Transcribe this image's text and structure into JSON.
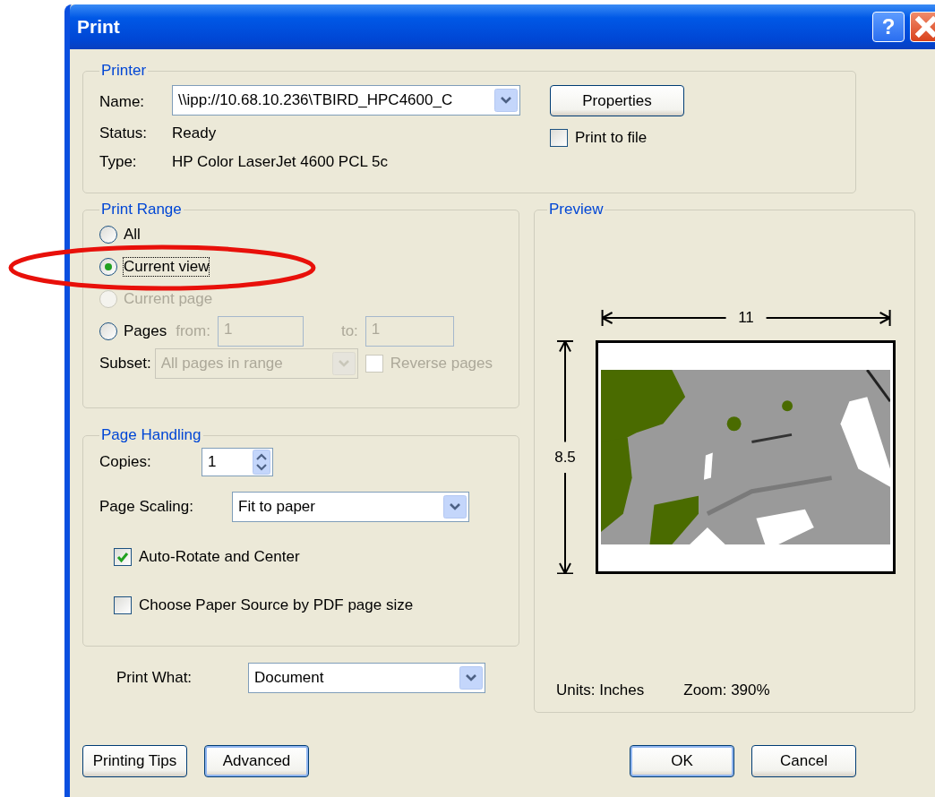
{
  "window": {
    "title": "Print"
  },
  "title_buttons": [
    {
      "kind": "help",
      "label": "?"
    },
    {
      "kind": "close"
    }
  ],
  "printer": {
    "title": "Printer",
    "name_label": "Name:",
    "name_value": "\\\\ipp://10.68.10.236\\TBIRD_HPC4600_C",
    "status_label": "Status:",
    "status": "Ready",
    "type_label": "Type:",
    "type": "HP Color LaserJet 4600 PCL 5c",
    "properties_button": "Properties",
    "print_to_file": {
      "label": "Print to file",
      "checked": false
    }
  },
  "print_range": {
    "title": "Print Range",
    "options": [
      {
        "label": "All",
        "selected": false,
        "disabled": false,
        "focused": false
      },
      {
        "label": "Current view",
        "selected": true,
        "disabled": false,
        "focused": true
      },
      {
        "label": "Current page",
        "selected": false,
        "disabled": true,
        "focused": false
      },
      {
        "label": "Pages",
        "selected": false,
        "disabled": false,
        "focused": false
      }
    ],
    "from_label": "from:",
    "from_value": "1",
    "to_label": "to:",
    "to_value": "1",
    "page_fields_disabled": true,
    "subset_label": "Subset:",
    "subset_value": "All pages in range",
    "subset_disabled": true,
    "reverse_pages": {
      "label": "Reverse pages",
      "checked": false,
      "disabled": true
    }
  },
  "page_handling": {
    "title": "Page Handling",
    "copies_label": "Copies:",
    "copies_value": "1",
    "scaling_label": "Page Scaling:",
    "scaling_value": "Fit to paper",
    "options": [
      {
        "label": "Auto-Rotate and Center",
        "checked": true
      },
      {
        "label": "Choose Paper Source by PDF page size",
        "checked": false
      }
    ]
  },
  "print_what": {
    "label": "Print What:",
    "value": "Document"
  },
  "preview": {
    "title": "Preview",
    "width_label": "11",
    "height_label": "8.5",
    "units": "Units: Inches",
    "zoom": "Zoom: 390%"
  },
  "buttons": [
    {
      "label": "Printing Tips",
      "default": false
    },
    {
      "label": "Advanced",
      "default": true
    },
    {
      "label": "OK",
      "default": true
    },
    {
      "label": "Cancel",
      "default": false
    }
  ],
  "annotation": {
    "kind": "ellipse"
  }
}
